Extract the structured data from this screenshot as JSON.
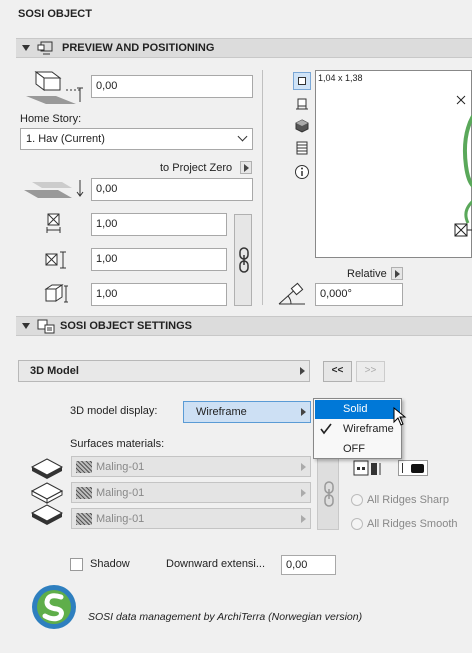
{
  "title": "SOSI OBJECT",
  "preview_section": {
    "label": "PREVIEW AND POSITIONING",
    "elevation_value": "0,00",
    "home_story_label": "Home Story:",
    "home_story_value": "1. Hav (Current)",
    "project_zero_label": "to Project Zero",
    "zero_value": "0,00",
    "width_value": "1,00",
    "depth_value": "1,00",
    "height_value": "1,00",
    "preview_dims": "1,04 x 1,38",
    "relative_label": "Relative",
    "angle_value": "0,000°"
  },
  "settings_section": {
    "label": "SOSI OBJECT SETTINGS",
    "page_select": "3D Model",
    "prev_button": "<<",
    "next_button": ">>",
    "model_display_label": "3D model display:",
    "model_display_value": "Wireframe",
    "surfaces_label": "Surfaces materials:",
    "materials": [
      "Maling-01",
      "Maling-01",
      "Maling-01"
    ],
    "ridges_sharp": "All Ridges Sharp",
    "ridges_smooth": "All Ridges Smooth",
    "shadow_label": "Shadow",
    "downward_label": "Downward extensi...",
    "downward_value": "0,00"
  },
  "display_menu": {
    "items": [
      "Solid",
      "Wireframe",
      "OFF"
    ],
    "highlighted": "Solid",
    "checked": "Wireframe",
    "highlight_color": "#0078d7"
  },
  "footer": {
    "text": "SOSI data management by ArchiTerra (Norwegian version)"
  }
}
